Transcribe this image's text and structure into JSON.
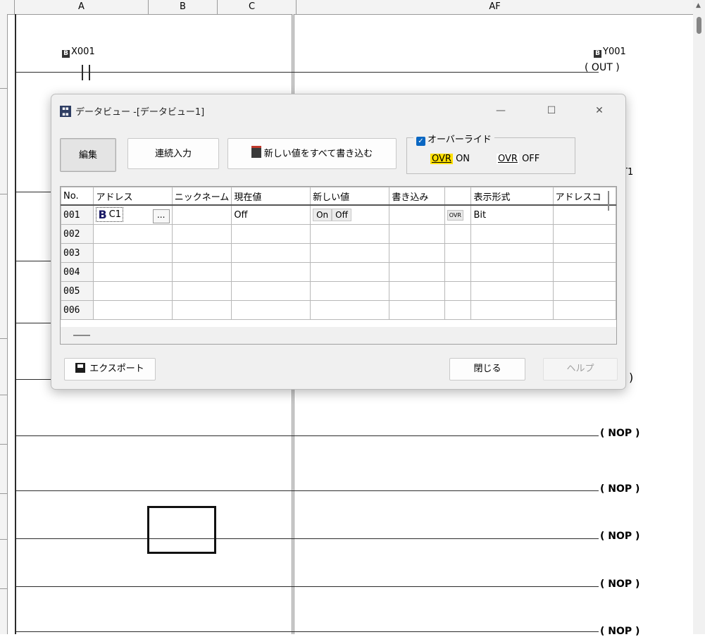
{
  "ladder": {
    "columns": [
      "A",
      "B",
      "C",
      "AF"
    ],
    "input_device": "X001",
    "output_device": "Y001",
    "output_instruction": "OUT",
    "partial_label": "T1",
    "nop_label": "( NOP )",
    "nop_last_label": "( NOP )"
  },
  "dialog": {
    "title": "データビュー -[データビュー1]",
    "window_buttons": {
      "minimize": "—",
      "maximize": "☐",
      "close": "✕"
    },
    "toolbar": {
      "edit": "編集",
      "continuous_input": "連続入力",
      "write_all": "新しい値をすべて書き込む"
    },
    "override": {
      "label": "オーバーライド",
      "checked": true,
      "ovr_on_tag": "OVR",
      "ovr_on_text": "ON",
      "ovr_off_tag": "OVR",
      "ovr_off_text": "OFF"
    },
    "grid": {
      "headers": [
        "No.",
        "アドレス",
        "ニックネーム",
        "現在値",
        "新しい値",
        "書き込み",
        "",
        "表示形式",
        "アドレスコ"
      ],
      "row_numbers": [
        "001",
        "002",
        "003",
        "004",
        "005",
        "006"
      ],
      "row1": {
        "address": "C1",
        "ellipsis": "...",
        "current_value": "Off",
        "new_on": "On",
        "new_off": "Off",
        "ovr_button": "OVR",
        "display_format": "Bit"
      }
    },
    "footer": {
      "export": "エクスポート",
      "close": "閉じる",
      "help": "ヘルプ"
    }
  }
}
